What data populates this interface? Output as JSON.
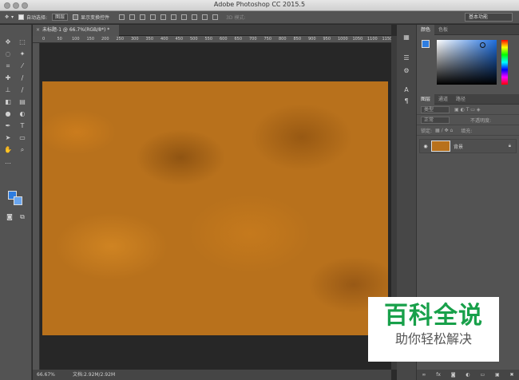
{
  "window": {
    "title": "Adobe Photoshop CC 2015.5"
  },
  "options_bar": {
    "auto_select_label": "自动选择:",
    "auto_select_value": "图层",
    "show_transform_label": "显示变换控件",
    "mode_3d_label": "3D 模式:",
    "workspace": "基本功能"
  },
  "document": {
    "tab_title": "未标题-1 @ 66.7%(RGB/8*) *"
  },
  "ruler": {
    "ticks": [
      "0",
      "50",
      "100",
      "150",
      "200",
      "250",
      "300",
      "350",
      "400",
      "450",
      "500",
      "550",
      "600",
      "650",
      "700",
      "750",
      "800",
      "850",
      "900",
      "950",
      "1000",
      "1050",
      "1100",
      "1150"
    ]
  },
  "status": {
    "zoom": "66.67%",
    "doc_size": "文档:2.92M/2.92M"
  },
  "color_panel": {
    "tabs": [
      "颜色",
      "色板"
    ],
    "foreground": "#2e7de0",
    "background": "#6aa6ef"
  },
  "layers_panel": {
    "tabs": [
      "图层",
      "通道",
      "路径"
    ],
    "filter_kind": "类型",
    "blend_mode": "正常",
    "opacity_label": "不透明度:",
    "lock_label": "锁定:",
    "fill_label": "填充:",
    "layers": [
      {
        "name": "背景",
        "visible": true,
        "locked": true
      }
    ]
  },
  "watermark": {
    "title": "百科全说",
    "subtitle": "助你轻松解决"
  },
  "canvas": {
    "fill": "clouds",
    "color": "#b8711c"
  }
}
